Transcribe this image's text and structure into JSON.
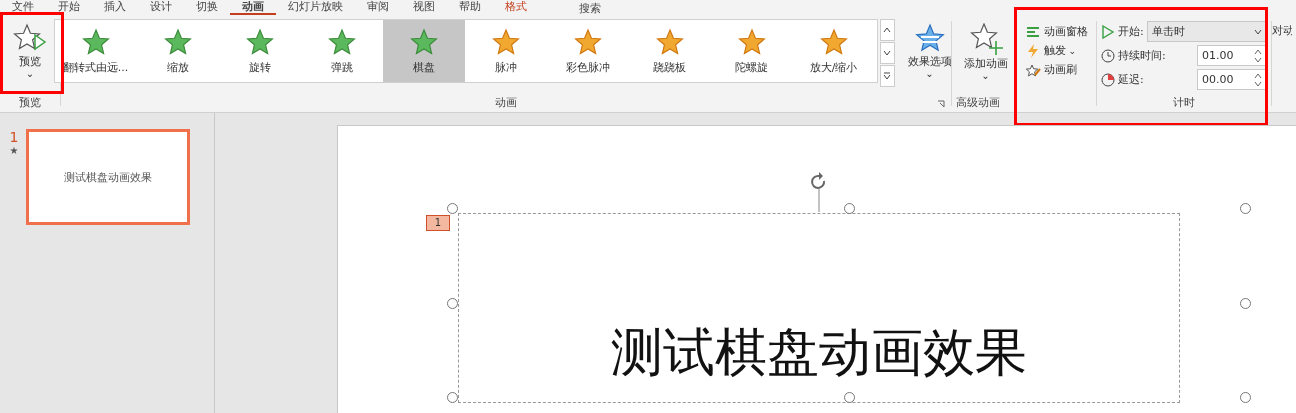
{
  "menu_tabs": [
    {
      "label": "文件",
      "selected": false
    },
    {
      "label": "开始",
      "selected": false
    },
    {
      "label": "插入",
      "selected": false
    },
    {
      "label": "设计",
      "selected": false
    },
    {
      "label": "切换",
      "selected": false
    },
    {
      "label": "动画",
      "selected": true
    },
    {
      "label": "幻灯片放映",
      "selected": false
    },
    {
      "label": "审阅",
      "selected": false
    },
    {
      "label": "视图",
      "selected": false
    },
    {
      "label": "帮助",
      "selected": false
    },
    {
      "label": "格式",
      "selected": false
    }
  ],
  "search": {
    "label": "搜索"
  },
  "preview_group": {
    "button": "预览",
    "caret": "⌄",
    "label": "预览"
  },
  "animation_group": {
    "label": "动画",
    "effects": [
      {
        "label": "翻转式由远...",
        "color": "#5cb85c",
        "selected": false
      },
      {
        "label": "缩放",
        "color": "#5cb85c",
        "selected": false
      },
      {
        "label": "旋转",
        "color": "#5cb85c",
        "selected": false
      },
      {
        "label": "弹跳",
        "color": "#5cb85c",
        "selected": false
      },
      {
        "label": "棋盘",
        "color": "#5cb85c",
        "selected": true
      },
      {
        "label": "脉冲",
        "color": "#f0a830",
        "selected": false
      },
      {
        "label": "彩色脉冲",
        "color": "#f0a830",
        "selected": false
      },
      {
        "label": "跷跷板",
        "color": "#f0a830",
        "selected": false
      },
      {
        "label": "陀螺旋",
        "color": "#f0a830",
        "selected": false
      },
      {
        "label": "放大/缩小",
        "color": "#f0a830",
        "selected": false
      }
    ],
    "effect_options": "效果选项",
    "caret": "⌄"
  },
  "advanced_group": {
    "label": "高级动画",
    "add_animation": "添加动画",
    "caret": "⌄",
    "items": [
      {
        "label": "动画窗格",
        "kind": "pane"
      },
      {
        "label": "触发",
        "kind": "trigger",
        "caret": "⌄"
      },
      {
        "label": "动画刷",
        "kind": "painter"
      }
    ]
  },
  "timing_group": {
    "label": "计时",
    "start_label": "开始:",
    "start_value": "单击时",
    "duration_label": "持续时间:",
    "duration_value": "01.00",
    "delay_label": "延迟:",
    "delay_value": "00.00",
    "reorder_label": "对动"
  },
  "slides": [
    {
      "number": "1",
      "animation_mark": "★",
      "title": "测试棋盘动画效果",
      "selected": true
    }
  ],
  "slide": {
    "animation_badge": "1",
    "text": "测试棋盘动画效果"
  }
}
